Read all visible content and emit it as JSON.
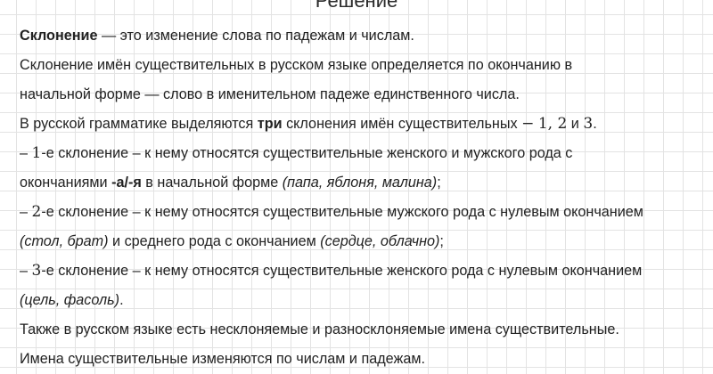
{
  "title": "Решение",
  "para1": {
    "term": "Склонение",
    "rest": " — это изменение слова по падежам и числам."
  },
  "para2": {
    "line1": "Склонение имён существительных в русском языке определяется по окончанию в",
    "line2": "начальной форме — слово в именительном падеже единственного числа."
  },
  "para3": {
    "before": "В русской грамматике выделяются ",
    "bold": "три",
    "after": " склонения имён существительных ",
    "dash": "−",
    "n1": "1",
    "comma": ", ",
    "n2": "2",
    "and": " и ",
    "n3": "3",
    "end": "."
  },
  "decl1": {
    "prefix": "– ",
    "num": "1",
    "line1_rest": "-е склонение – к нему относятся существительные женского и мужского рода с",
    "line2_start": "окончаниями ",
    "endings": "-а/-я",
    "line2_mid": " в начальной форме ",
    "examples": "(папа, яблоня, малина)",
    "line2_end": ";"
  },
  "decl2": {
    "prefix": "– ",
    "num": "2",
    "line1_rest": "-е склонение – к нему относятся существительные мужского рода с нулевым окончанием",
    "examples1": "(стол, брат)",
    "line2_mid": " и среднего рода с окончанием ",
    "examples2": "(сердце, облачно)",
    "line2_end": ";"
  },
  "decl3": {
    "prefix": "– ",
    "num": "3",
    "line1_rest": "-е склонение – к нему относятся существительные женского рода с нулевым окончанием",
    "examples": "(цель, фасоль)",
    "line2_end": "."
  },
  "para_last1": "Также в русском языке есть несклоняемые и разносклоняемые имена существительные.",
  "para_last2": "Имена существительные изменяются по числам и падежам."
}
